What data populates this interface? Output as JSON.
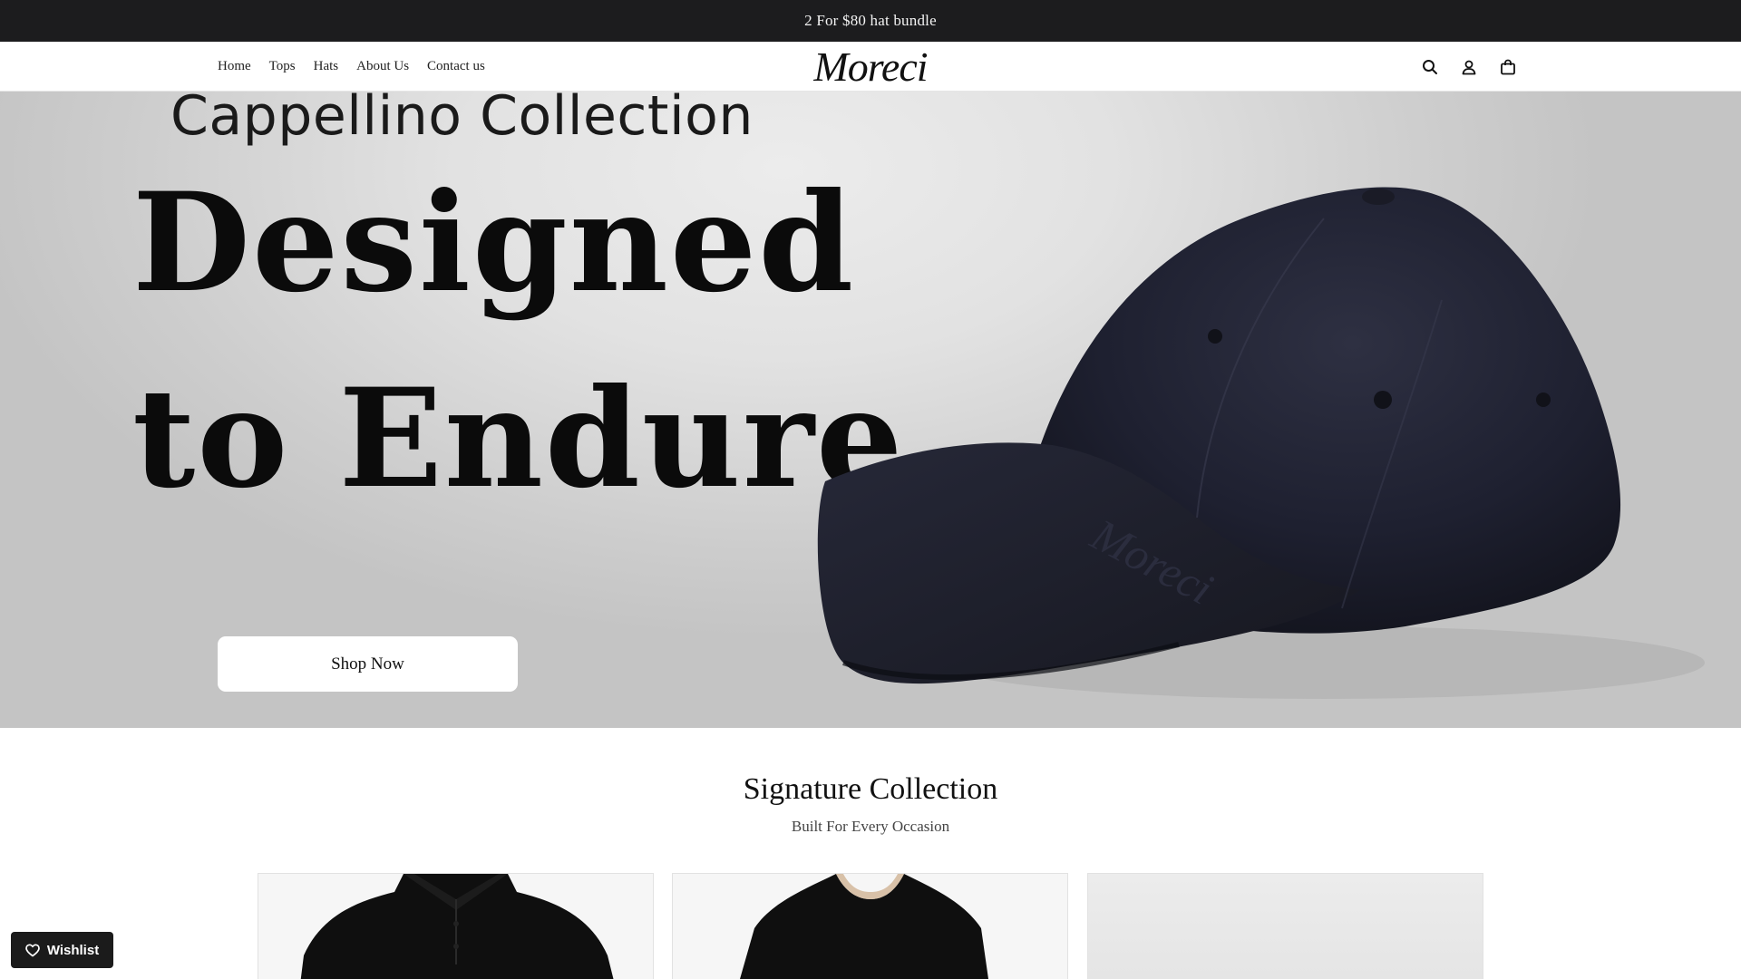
{
  "announcement": "2 For $80 hat bundle",
  "nav": [
    {
      "label": "Home"
    },
    {
      "label": "Tops"
    },
    {
      "label": "Hats"
    },
    {
      "label": "About Us"
    },
    {
      "label": "Contact us"
    }
  ],
  "brand": {
    "logo": "Moreci"
  },
  "header_icons": [
    "search-icon",
    "account-icon",
    "cart-icon"
  ],
  "hero": {
    "eyebrow": "Cappellino Collection",
    "headline_line1": "Designed",
    "headline_line2": "to Endure",
    "cap_embroidery": "Moreci",
    "cta": "Shop Now"
  },
  "collection": {
    "title": "Signature Collection",
    "subtitle": "Built For Every Occasion",
    "products": [
      {
        "image": "black polo shirt"
      },
      {
        "image": "black crew neck t-shirt"
      },
      {
        "image": "light grey product image"
      }
    ]
  },
  "wishlist": {
    "label": "Wishlist",
    "icon": "heart-icon"
  },
  "colors": {
    "announcement_bg": "#1c1c1e",
    "cap": "#1e2030",
    "wishlist_bg": "#1b1b1b"
  }
}
